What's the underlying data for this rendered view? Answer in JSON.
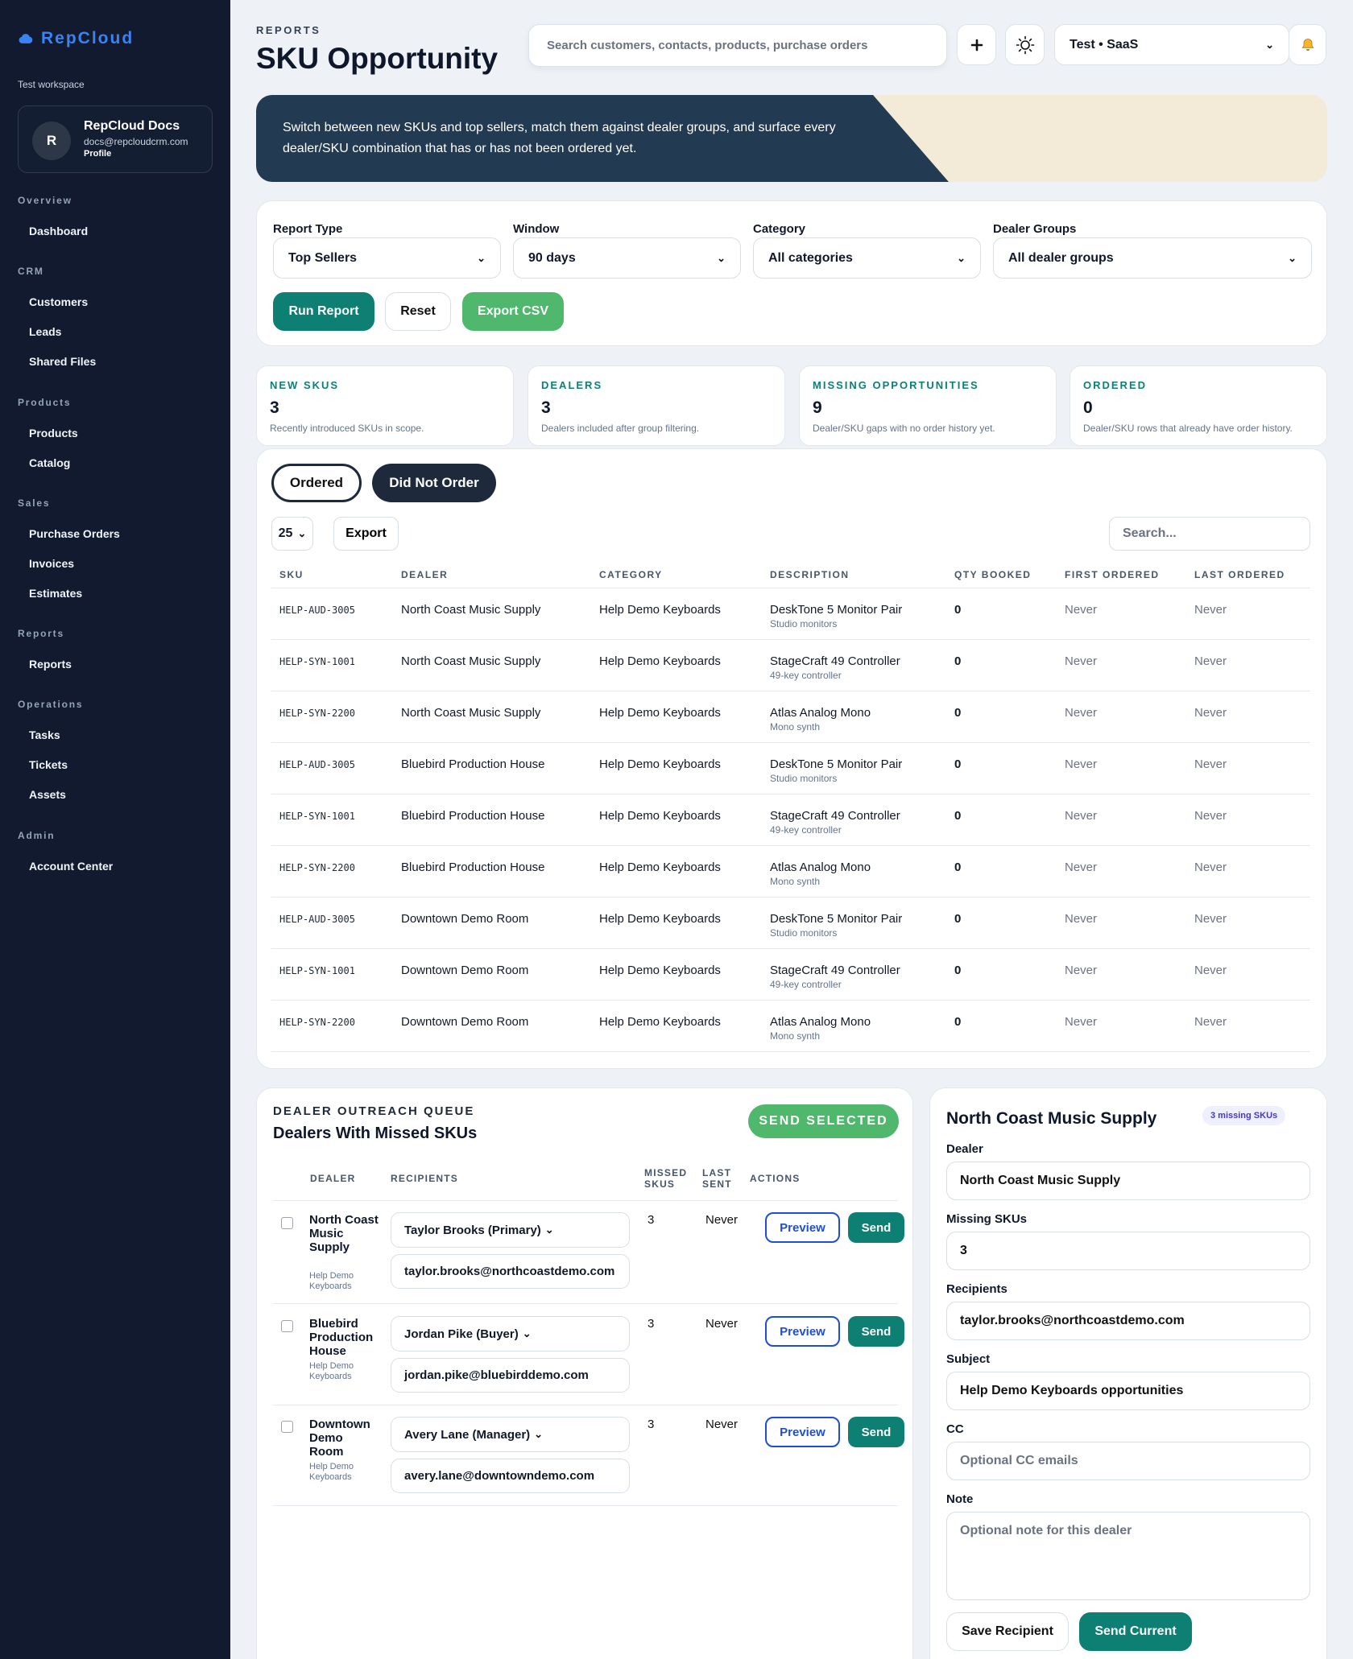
{
  "sidebar": {
    "brand": "RepCloud",
    "workspace_label": "Test workspace",
    "profile": {
      "initial": "R",
      "name": "RepCloud Docs",
      "email": "docs@repcloudcrm.com",
      "link": "Profile"
    },
    "sections": [
      {
        "title": "Overview",
        "items": [
          "Dashboard"
        ]
      },
      {
        "title": "CRM",
        "items": [
          "Customers",
          "Leads",
          "Shared Files"
        ]
      },
      {
        "title": "Products",
        "items": [
          "Products",
          "Catalog"
        ]
      },
      {
        "title": "Sales",
        "items": [
          "Purchase Orders",
          "Invoices",
          "Estimates"
        ]
      },
      {
        "title": "Reports",
        "items": [
          "Reports"
        ]
      },
      {
        "title": "Operations",
        "items": [
          "Tasks",
          "Tickets",
          "Assets"
        ]
      },
      {
        "title": "Admin",
        "items": [
          "Account Center"
        ]
      }
    ]
  },
  "header": {
    "eyebrow": "REPORTS",
    "title": "SKU Opportunity",
    "search_placeholder": "Search customers, contacts, products, purchase orders",
    "workspace_select": "Test • SaaS",
    "icons": [
      "plus-icon",
      "sun-icon",
      "bell-icon"
    ]
  },
  "banner": {
    "text": "Switch between new SKUs and top sellers, match them against dealer groups, and surface every dealer/SKU combination that has or has not been ordered yet."
  },
  "filters": {
    "fields": [
      {
        "label": "Report Type",
        "value": "Top Sellers"
      },
      {
        "label": "Window",
        "value": "90 days"
      },
      {
        "label": "Category",
        "value": "All categories"
      },
      {
        "label": "Dealer Groups",
        "value": "All dealer groups"
      }
    ],
    "run": "Run Report",
    "reset": "Reset",
    "export": "Export CSV"
  },
  "stats": [
    {
      "label": "NEW SKUS",
      "value": "3",
      "desc": "Recently introduced SKUs in scope."
    },
    {
      "label": "DEALERS",
      "value": "3",
      "desc": "Dealers included after group filtering."
    },
    {
      "label": "MISSING OPPORTUNITIES",
      "value": "9",
      "desc": "Dealer/SKU gaps with no order history yet."
    },
    {
      "label": "ORDERED",
      "value": "0",
      "desc": "Dealer/SKU rows that already have order history."
    }
  ],
  "table": {
    "tabs": [
      "Ordered",
      "Did Not Order"
    ],
    "page_size": "25",
    "export": "Export",
    "search_placeholder": "Search...",
    "columns": [
      "SKU",
      "DEALER",
      "CATEGORY",
      "DESCRIPTION",
      "QTY BOOKED",
      "FIRST ORDERED",
      "LAST ORDERED"
    ],
    "rows": [
      {
        "sku": "HELP-AUD-3005",
        "dealer": "North Coast Music Supply",
        "category": "Help Demo Keyboards",
        "desc": "DeskTone 5 Monitor Pair",
        "sub": "Studio monitors",
        "qty": "0",
        "first": "Never",
        "last": "Never"
      },
      {
        "sku": "HELP-SYN-1001",
        "dealer": "North Coast Music Supply",
        "category": "Help Demo Keyboards",
        "desc": "StageCraft 49 Controller",
        "sub": "49-key controller",
        "qty": "0",
        "first": "Never",
        "last": "Never"
      },
      {
        "sku": "HELP-SYN-2200",
        "dealer": "North Coast Music Supply",
        "category": "Help Demo Keyboards",
        "desc": "Atlas Analog Mono",
        "sub": "Mono synth",
        "qty": "0",
        "first": "Never",
        "last": "Never"
      },
      {
        "sku": "HELP-AUD-3005",
        "dealer": "Bluebird Production House",
        "category": "Help Demo Keyboards",
        "desc": "DeskTone 5 Monitor Pair",
        "sub": "Studio monitors",
        "qty": "0",
        "first": "Never",
        "last": "Never"
      },
      {
        "sku": "HELP-SYN-1001",
        "dealer": "Bluebird Production House",
        "category": "Help Demo Keyboards",
        "desc": "StageCraft 49 Controller",
        "sub": "49-key controller",
        "qty": "0",
        "first": "Never",
        "last": "Never"
      },
      {
        "sku": "HELP-SYN-2200",
        "dealer": "Bluebird Production House",
        "category": "Help Demo Keyboards",
        "desc": "Atlas Analog Mono",
        "sub": "Mono synth",
        "qty": "0",
        "first": "Never",
        "last": "Never"
      },
      {
        "sku": "HELP-AUD-3005",
        "dealer": "Downtown Demo Room",
        "category": "Help Demo Keyboards",
        "desc": "DeskTone 5 Monitor Pair",
        "sub": "Studio monitors",
        "qty": "0",
        "first": "Never",
        "last": "Never"
      },
      {
        "sku": "HELP-SYN-1001",
        "dealer": "Downtown Demo Room",
        "category": "Help Demo Keyboards",
        "desc": "StageCraft 49 Controller",
        "sub": "49-key controller",
        "qty": "0",
        "first": "Never",
        "last": "Never"
      },
      {
        "sku": "HELP-SYN-2200",
        "dealer": "Downtown Demo Room",
        "category": "Help Demo Keyboards",
        "desc": "Atlas Analog Mono",
        "sub": "Mono synth",
        "qty": "0",
        "first": "Never",
        "last": "Never"
      }
    ]
  },
  "outreach": {
    "eyebrow": "DEALER OUTREACH QUEUE",
    "title": "Dealers With Missed SKUs",
    "send_selected": "SEND SELECTED",
    "columns": {
      "dealer": "DEALER",
      "recipients": "RECIPIENTS",
      "missed": "MISSED SKUS",
      "last": "LAST SENT",
      "actions": "ACTIONS"
    },
    "preview": "Preview",
    "send": "Send",
    "rows": [
      {
        "dealer": "North Coast Music Supply",
        "category": "Help Demo Keyboards",
        "recipient": "Taylor Brooks (Primary)",
        "email": "taylor.brooks@northcoastdemo.com",
        "missed": "3",
        "last": "Never"
      },
      {
        "dealer": "Bluebird Production House",
        "category": "Help Demo Keyboards",
        "recipient": "Jordan Pike (Buyer)",
        "email": "jordan.pike@bluebirddemo.com",
        "missed": "3",
        "last": "Never"
      },
      {
        "dealer": "Downtown Demo Room",
        "category": "Help Demo Keyboards",
        "recipient": "Avery Lane (Manager)",
        "email": "avery.lane@downtowndemo.com",
        "missed": "3",
        "last": "Never"
      }
    ]
  },
  "detail": {
    "title": "North Coast Music Supply",
    "badge": "3 missing SKUs",
    "dealer_label": "Dealer",
    "dealer": "North Coast Music Supply",
    "missing_label": "Missing SKUs",
    "missing": "3",
    "recipients_label": "Recipients",
    "recipients": "taylor.brooks@northcoastdemo.com",
    "subject_label": "Subject",
    "subject": "Help Demo Keyboards opportunities",
    "cc_label": "CC",
    "cc_placeholder": "Optional CC emails",
    "note_label": "Note",
    "note_placeholder": "Optional note for this dealer",
    "save": "Save Recipient",
    "send": "Send Current"
  },
  "colors": {
    "sidebar": "#111a2e",
    "teal": "#0e7f73",
    "green": "#4fb86c",
    "banner_dark": "#223a52",
    "banner_light": "#f3ead7",
    "link_blue": "#1d4ed8"
  }
}
